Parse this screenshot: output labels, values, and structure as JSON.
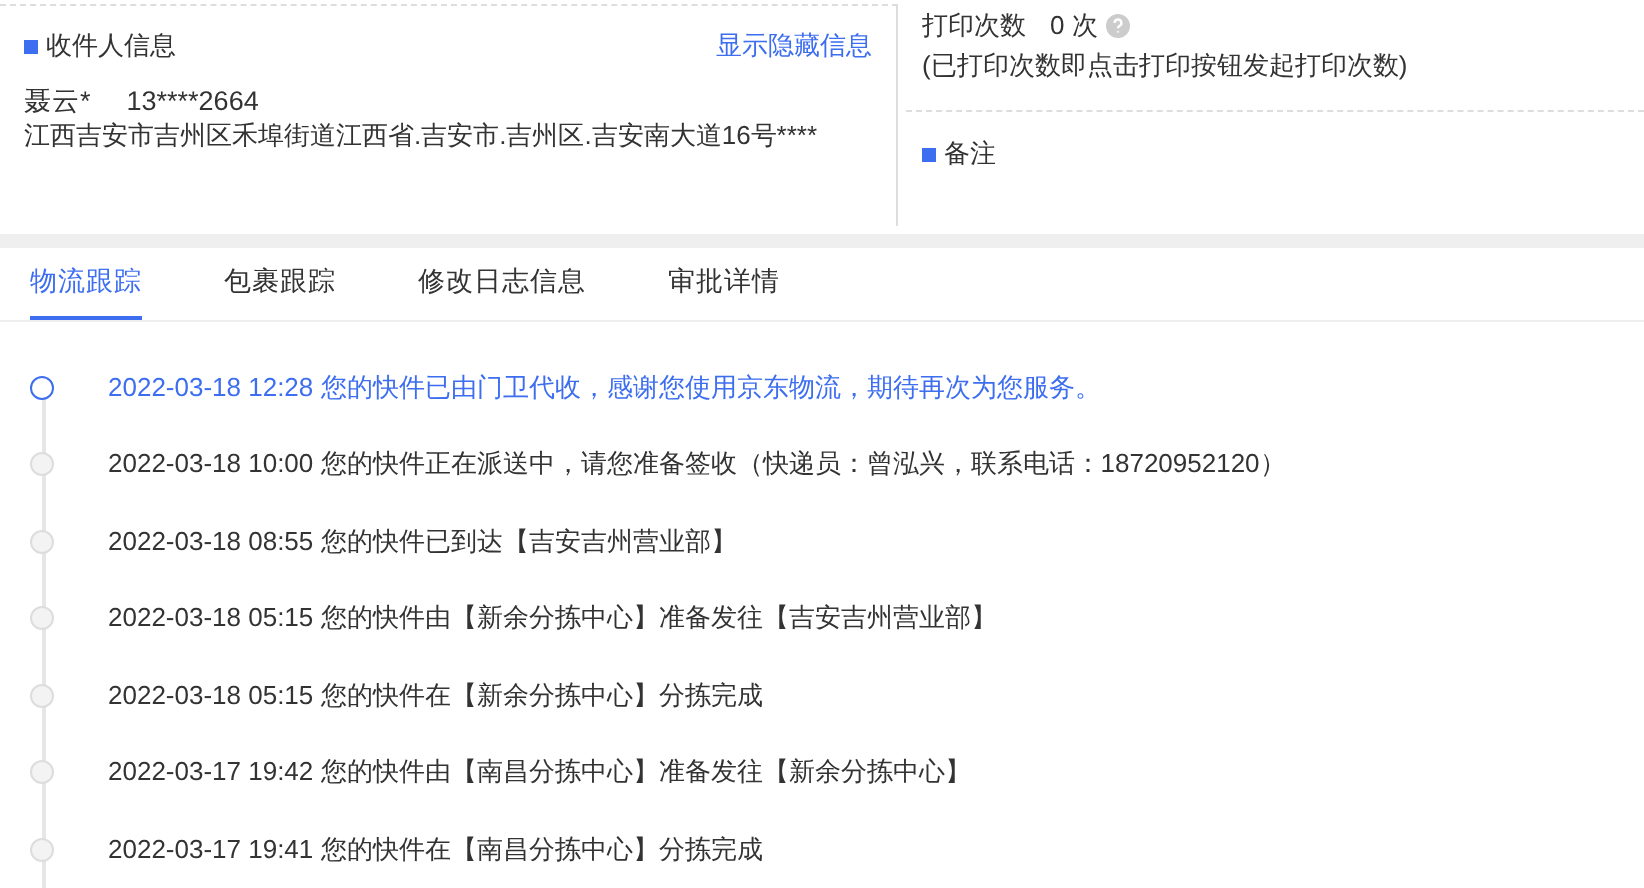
{
  "recipient": {
    "title": "收件人信息",
    "toggle_link": "显示隐藏信息",
    "name": "聂云*",
    "phone": "13****2664",
    "address": "江西吉安市吉州区禾埠街道江西省.吉安市.吉州区.吉安南大道16号****"
  },
  "print": {
    "label": "打印次数",
    "count": "0 次",
    "note": "(已打印次数即点击打印按钮发起打印次数)"
  },
  "remarks": {
    "title": "备注"
  },
  "tabs": [
    {
      "label": "物流跟踪",
      "selected": true
    },
    {
      "label": "包裹跟踪",
      "selected": false
    },
    {
      "label": "修改日志信息",
      "selected": false
    },
    {
      "label": "审批详情",
      "selected": false
    }
  ],
  "timeline": [
    {
      "text": "2022-03-18 12:28 您的快件已由门卫代收，感谢您使用京东物流，期待再次为您服务。",
      "current": true
    },
    {
      "text": "2022-03-18 10:00 您的快件正在派送中，请您准备签收（快递员：曾泓兴，联系电话：18720952120）",
      "current": false
    },
    {
      "text": "2022-03-18 08:55 您的快件已到达【吉安吉州营业部】",
      "current": false
    },
    {
      "text": "2022-03-18 05:15 您的快件由【新余分拣中心】准备发往【吉安吉州营业部】",
      "current": false
    },
    {
      "text": "2022-03-18 05:15 您的快件在【新余分拣中心】分拣完成",
      "current": false
    },
    {
      "text": "2022-03-17 19:42 您的快件由【南昌分拣中心】准备发往【新余分拣中心】",
      "current": false
    },
    {
      "text": "2022-03-17 19:41 您的快件在【南昌分拣中心】分拣完成",
      "current": false
    }
  ]
}
